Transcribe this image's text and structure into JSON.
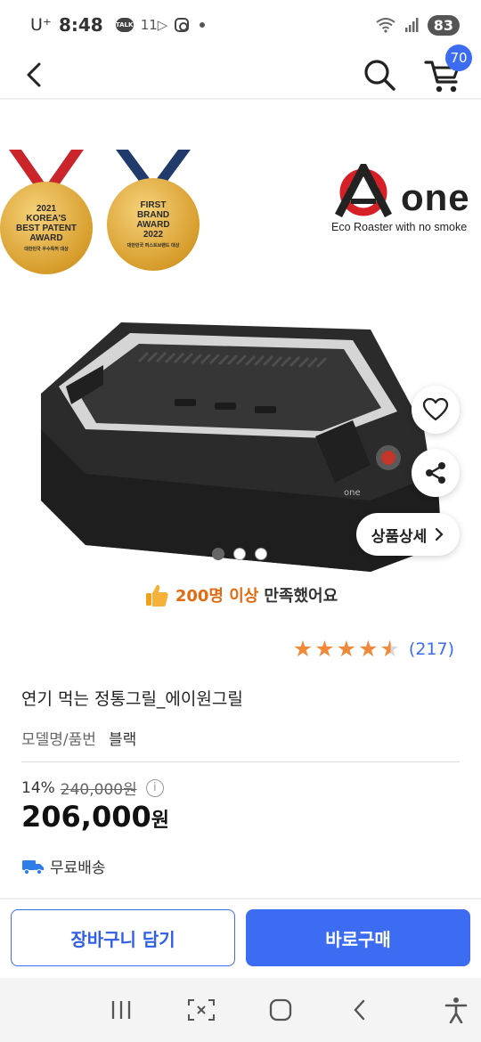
{
  "status_bar": {
    "carrier": "U⁺",
    "time": "8:48",
    "talk_icon_label": "TALK",
    "notif_text": "11",
    "battery": "83"
  },
  "nav": {
    "cart_count": "70"
  },
  "hero": {
    "medal1_lines": [
      "2021",
      "KOREA'S",
      "BEST PATENT",
      "AWARD"
    ],
    "medal1_sub": "대한민국 우수특허 대상",
    "medal2_lines": [
      "FIRST",
      "BRAND",
      "AWARD",
      "2022"
    ],
    "medal2_sub": "대한민국 퍼스트브랜드 대상",
    "brand_name": "one",
    "brand_tagline": "Eco Roaster with no smoke",
    "detail_label": "상품상세",
    "page_count": 3,
    "active_page": 1
  },
  "satisfaction": {
    "highlight": "200명 이상",
    "rest": "만족했어요"
  },
  "rating": {
    "stars": 4.5,
    "count": "(217)"
  },
  "product": {
    "title": "연기 먹는 정통그릴_에이원그릴",
    "model_label": "모델명/품번",
    "model_value": "블랙",
    "discount": "14%",
    "original_price": "240,000원",
    "sale_price_number": "206,000",
    "sale_price_unit": "원",
    "shipping": "무료배송"
  },
  "actions": {
    "cart_button": "장바구니 담기",
    "buy_button": "바로구매"
  },
  "colors": {
    "accent": "#3b6cf2",
    "star": "#f08a3a",
    "highlight": "#e26a10"
  }
}
